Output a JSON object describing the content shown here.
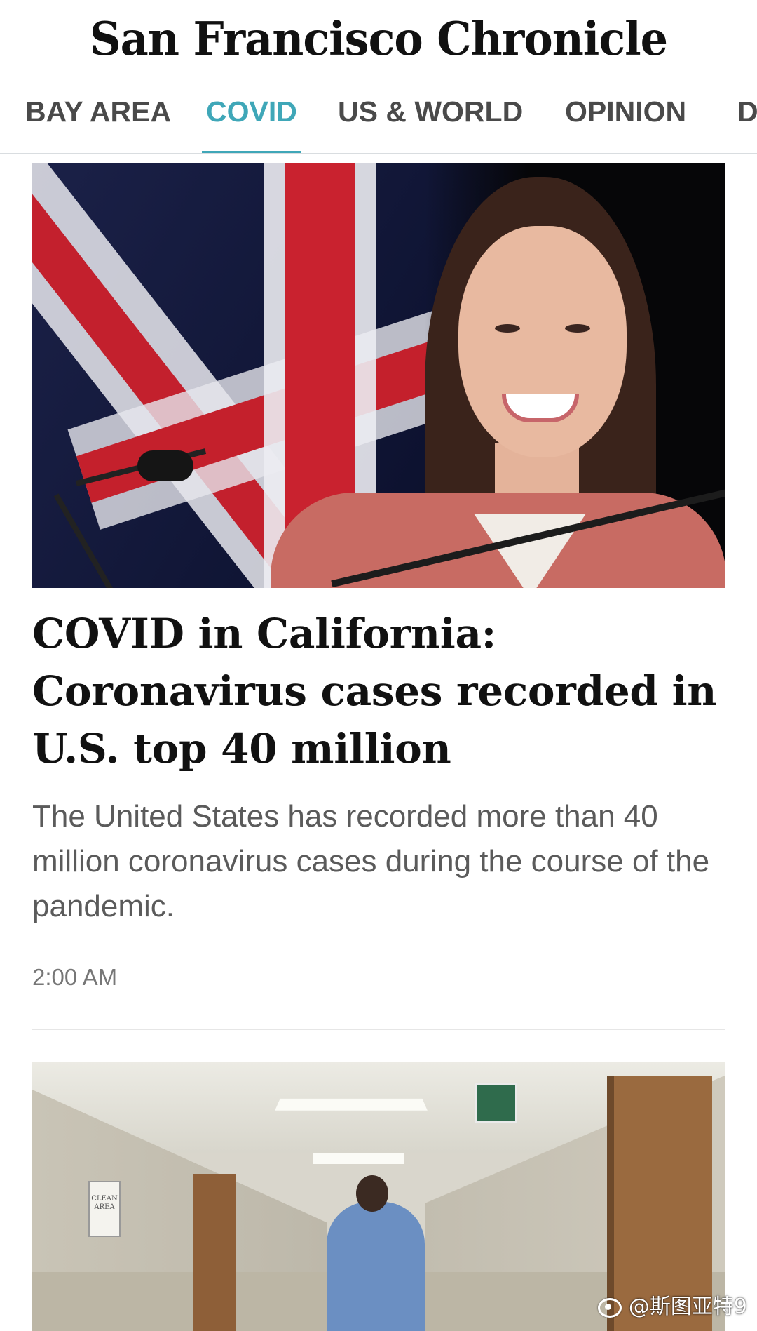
{
  "masthead": {
    "title": "San Francisco Chronicle"
  },
  "nav": {
    "tabs": [
      {
        "label": "BAY AREA",
        "active": false
      },
      {
        "label": "COVID",
        "active": true
      },
      {
        "label": "US & WORLD",
        "active": false
      },
      {
        "label": "OPINION",
        "active": false
      },
      {
        "label": "D",
        "active": false
      }
    ],
    "accent_color": "#3fa7b8"
  },
  "articles": [
    {
      "image_icon": "press-conference-photo",
      "headline": "COVID in California: Coronavirus cases recorded in U.S. top 40 million",
      "dek": "The United States has recorded more than 40 million coronavirus cases during the course of the pandemic.",
      "timestamp": "2:00 AM"
    },
    {
      "image_icon": "hospital-corridor-photo",
      "image_sign_text": "CLEAN AREA"
    }
  ],
  "watermark": {
    "icon": "weibo-icon",
    "text": "@斯图亚特9"
  }
}
